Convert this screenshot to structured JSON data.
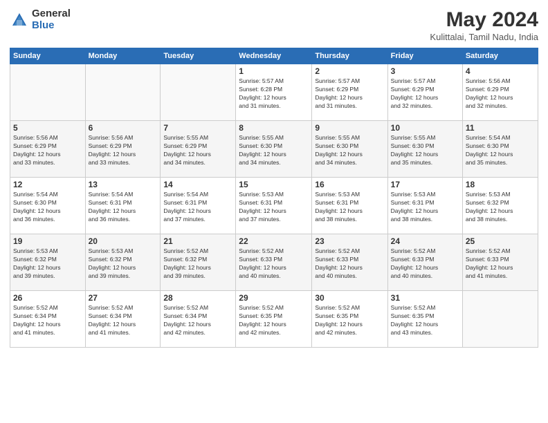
{
  "logo": {
    "general": "General",
    "blue": "Blue"
  },
  "title": "May 2024",
  "subtitle": "Kulittalai, Tamil Nadu, India",
  "days_header": [
    "Sunday",
    "Monday",
    "Tuesday",
    "Wednesday",
    "Thursday",
    "Friday",
    "Saturday"
  ],
  "weeks": [
    [
      {
        "day": "",
        "info": ""
      },
      {
        "day": "",
        "info": ""
      },
      {
        "day": "",
        "info": ""
      },
      {
        "day": "1",
        "info": "Sunrise: 5:57 AM\nSunset: 6:28 PM\nDaylight: 12 hours\nand 31 minutes."
      },
      {
        "day": "2",
        "info": "Sunrise: 5:57 AM\nSunset: 6:29 PM\nDaylight: 12 hours\nand 31 minutes."
      },
      {
        "day": "3",
        "info": "Sunrise: 5:57 AM\nSunset: 6:29 PM\nDaylight: 12 hours\nand 32 minutes."
      },
      {
        "day": "4",
        "info": "Sunrise: 5:56 AM\nSunset: 6:29 PM\nDaylight: 12 hours\nand 32 minutes."
      }
    ],
    [
      {
        "day": "5",
        "info": "Sunrise: 5:56 AM\nSunset: 6:29 PM\nDaylight: 12 hours\nand 33 minutes."
      },
      {
        "day": "6",
        "info": "Sunrise: 5:56 AM\nSunset: 6:29 PM\nDaylight: 12 hours\nand 33 minutes."
      },
      {
        "day": "7",
        "info": "Sunrise: 5:55 AM\nSunset: 6:29 PM\nDaylight: 12 hours\nand 34 minutes."
      },
      {
        "day": "8",
        "info": "Sunrise: 5:55 AM\nSunset: 6:30 PM\nDaylight: 12 hours\nand 34 minutes."
      },
      {
        "day": "9",
        "info": "Sunrise: 5:55 AM\nSunset: 6:30 PM\nDaylight: 12 hours\nand 34 minutes."
      },
      {
        "day": "10",
        "info": "Sunrise: 5:55 AM\nSunset: 6:30 PM\nDaylight: 12 hours\nand 35 minutes."
      },
      {
        "day": "11",
        "info": "Sunrise: 5:54 AM\nSunset: 6:30 PM\nDaylight: 12 hours\nand 35 minutes."
      }
    ],
    [
      {
        "day": "12",
        "info": "Sunrise: 5:54 AM\nSunset: 6:30 PM\nDaylight: 12 hours\nand 36 minutes."
      },
      {
        "day": "13",
        "info": "Sunrise: 5:54 AM\nSunset: 6:31 PM\nDaylight: 12 hours\nand 36 minutes."
      },
      {
        "day": "14",
        "info": "Sunrise: 5:54 AM\nSunset: 6:31 PM\nDaylight: 12 hours\nand 37 minutes."
      },
      {
        "day": "15",
        "info": "Sunrise: 5:53 AM\nSunset: 6:31 PM\nDaylight: 12 hours\nand 37 minutes."
      },
      {
        "day": "16",
        "info": "Sunrise: 5:53 AM\nSunset: 6:31 PM\nDaylight: 12 hours\nand 38 minutes."
      },
      {
        "day": "17",
        "info": "Sunrise: 5:53 AM\nSunset: 6:31 PM\nDaylight: 12 hours\nand 38 minutes."
      },
      {
        "day": "18",
        "info": "Sunrise: 5:53 AM\nSunset: 6:32 PM\nDaylight: 12 hours\nand 38 minutes."
      }
    ],
    [
      {
        "day": "19",
        "info": "Sunrise: 5:53 AM\nSunset: 6:32 PM\nDaylight: 12 hours\nand 39 minutes."
      },
      {
        "day": "20",
        "info": "Sunrise: 5:53 AM\nSunset: 6:32 PM\nDaylight: 12 hours\nand 39 minutes."
      },
      {
        "day": "21",
        "info": "Sunrise: 5:52 AM\nSunset: 6:32 PM\nDaylight: 12 hours\nand 39 minutes."
      },
      {
        "day": "22",
        "info": "Sunrise: 5:52 AM\nSunset: 6:33 PM\nDaylight: 12 hours\nand 40 minutes."
      },
      {
        "day": "23",
        "info": "Sunrise: 5:52 AM\nSunset: 6:33 PM\nDaylight: 12 hours\nand 40 minutes."
      },
      {
        "day": "24",
        "info": "Sunrise: 5:52 AM\nSunset: 6:33 PM\nDaylight: 12 hours\nand 40 minutes."
      },
      {
        "day": "25",
        "info": "Sunrise: 5:52 AM\nSunset: 6:33 PM\nDaylight: 12 hours\nand 41 minutes."
      }
    ],
    [
      {
        "day": "26",
        "info": "Sunrise: 5:52 AM\nSunset: 6:34 PM\nDaylight: 12 hours\nand 41 minutes."
      },
      {
        "day": "27",
        "info": "Sunrise: 5:52 AM\nSunset: 6:34 PM\nDaylight: 12 hours\nand 41 minutes."
      },
      {
        "day": "28",
        "info": "Sunrise: 5:52 AM\nSunset: 6:34 PM\nDaylight: 12 hours\nand 42 minutes."
      },
      {
        "day": "29",
        "info": "Sunrise: 5:52 AM\nSunset: 6:35 PM\nDaylight: 12 hours\nand 42 minutes."
      },
      {
        "day": "30",
        "info": "Sunrise: 5:52 AM\nSunset: 6:35 PM\nDaylight: 12 hours\nand 42 minutes."
      },
      {
        "day": "31",
        "info": "Sunrise: 5:52 AM\nSunset: 6:35 PM\nDaylight: 12 hours\nand 43 minutes."
      },
      {
        "day": "",
        "info": ""
      }
    ]
  ]
}
